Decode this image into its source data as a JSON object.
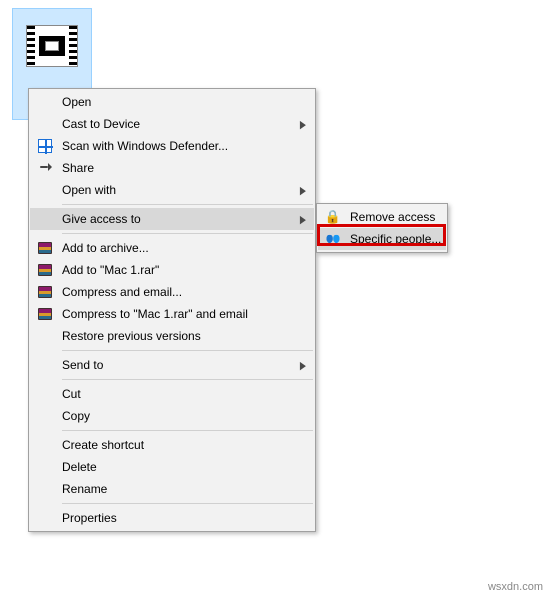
{
  "file": {
    "type": "video"
  },
  "main_menu": {
    "open": "Open",
    "cast": "Cast to Device",
    "defender": "Scan with Windows Defender...",
    "share": "Share",
    "open_with": "Open with",
    "give_access": "Give access to",
    "add_archive": "Add to archive...",
    "add_mac1": "Add to \"Mac 1.rar\"",
    "compress_email": "Compress and email...",
    "compress_mac1_email": "Compress to \"Mac 1.rar\" and email",
    "restore": "Restore previous versions",
    "send_to": "Send to",
    "cut": "Cut",
    "copy": "Copy",
    "shortcut": "Create shortcut",
    "delete": "Delete",
    "rename": "Rename",
    "properties": "Properties"
  },
  "sub_menu": {
    "remove": "Remove access",
    "specific": "Specific people..."
  },
  "source": "wsxdn.com"
}
